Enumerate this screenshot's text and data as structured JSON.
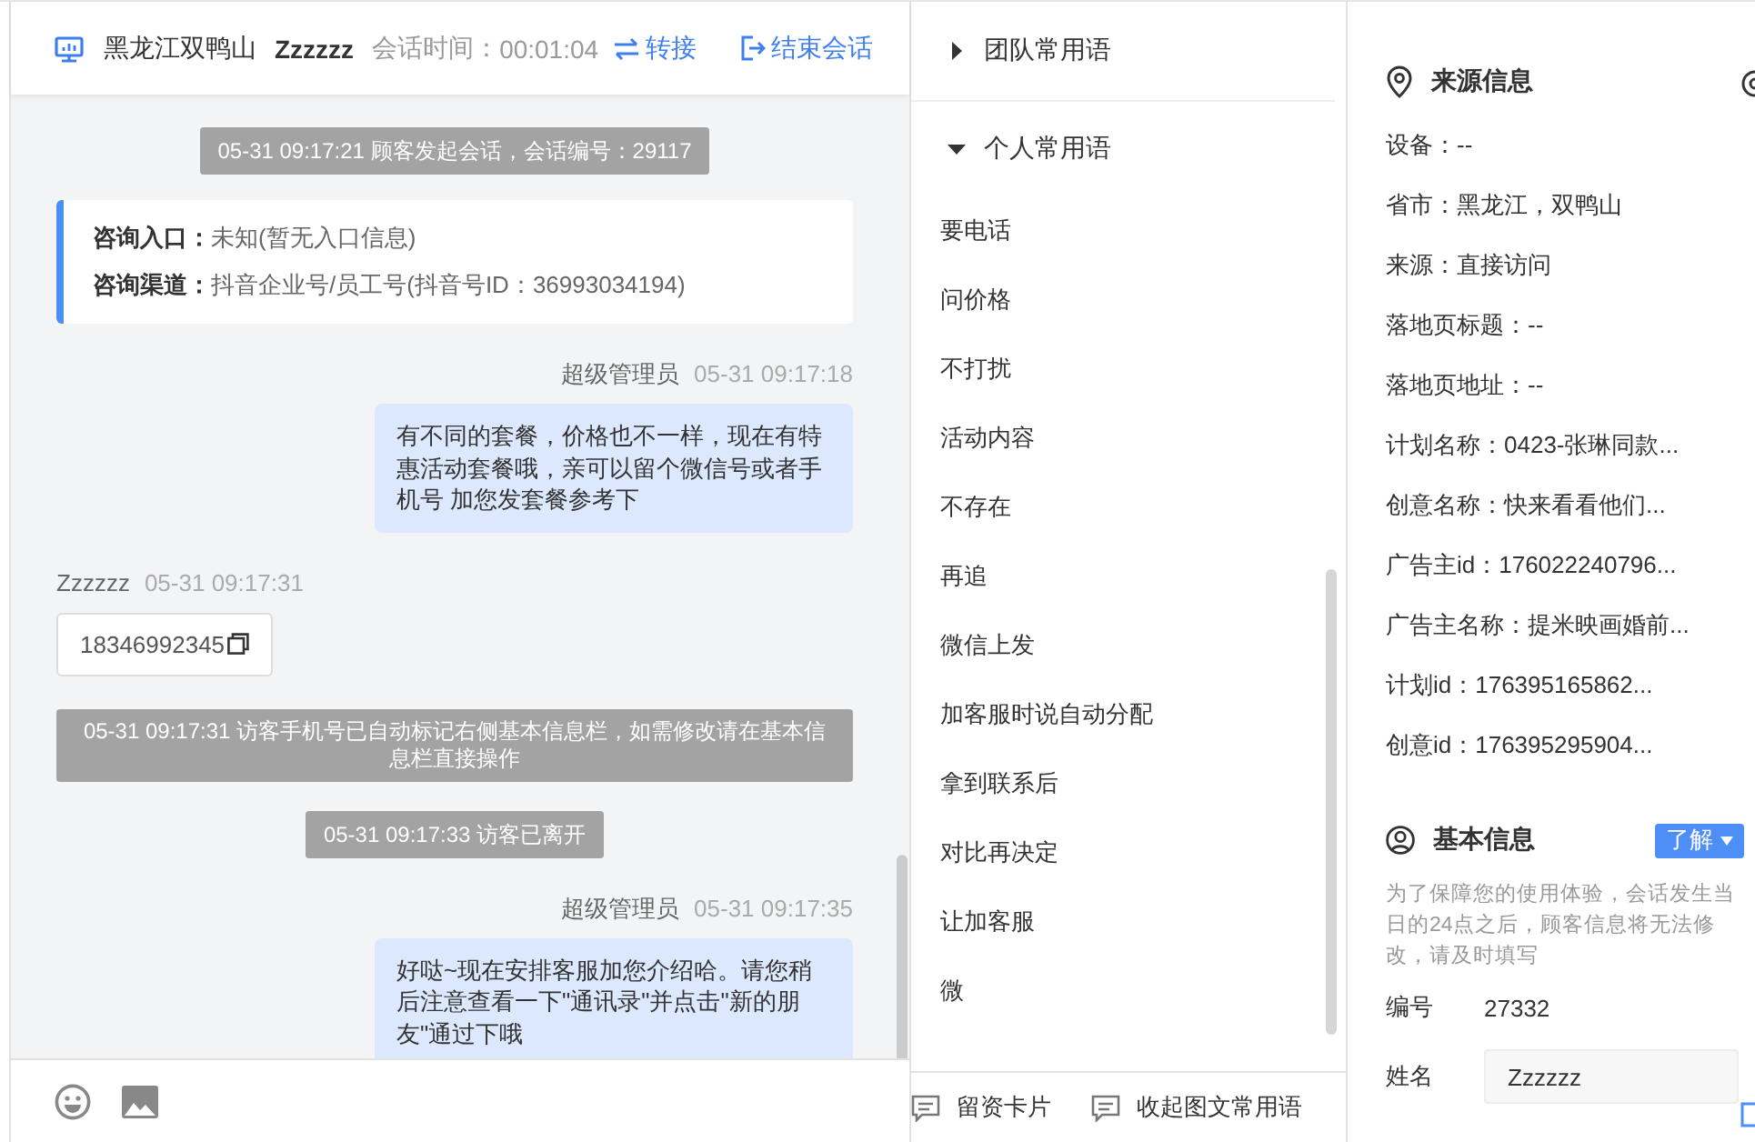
{
  "header": {
    "region": "黑龙江双鸭山",
    "visitor": "Zzzzzz",
    "duration_label": "会话时间：",
    "duration": "00:01:04",
    "transfer": "转接",
    "end": "结束会话"
  },
  "messages": [
    {
      "kind": "system",
      "text": "05-31 09:17:21 顾客发起会话，会话编号：29117"
    },
    {
      "kind": "info",
      "rows": [
        {
          "label": "咨询入口：",
          "value": "未知(暂无入口信息)"
        },
        {
          "label": "咨询渠道：",
          "value": "抖音企业号/员工号(抖音号ID：36993034194)"
        }
      ]
    },
    {
      "kind": "agent",
      "sender": "超级管理员",
      "time": "05-31 09:17:18",
      "text": "有不同的套餐，价格也不一样，现在有特惠活动套餐哦，亲可以留个微信号或者手机号 加您发套餐参考下"
    },
    {
      "kind": "visitor",
      "sender": "Zzzzzz",
      "time": "05-31 09:17:31",
      "text": "18346992345"
    },
    {
      "kind": "system",
      "text": "05-31 09:17:31 访客手机号已自动标记右侧基本信息栏，如需修改请在基本信息栏直接操作"
    },
    {
      "kind": "system",
      "text": "05-31 09:17:33 访客已离开"
    },
    {
      "kind": "agent",
      "sender": "超级管理员",
      "time": "05-31 09:17:35",
      "text": "好哒~现在安排客服加您介绍哈。请您稍后注意查看一下\"通讯录\"并点击\"新的朋友\"通过下哦"
    }
  ],
  "phrases": {
    "groups": [
      {
        "title": "团队常用语",
        "expanded": false
      },
      {
        "title": "个人常用语",
        "expanded": true,
        "items": [
          "要电话",
          "问价格",
          "不打扰",
          "活动内容",
          "不存在",
          "再追",
          "微信上发",
          "加客服时说自动分配",
          "拿到联系后",
          "对比再决定",
          "让加客服",
          "微"
        ]
      }
    ],
    "buttons": [
      "留资卡片",
      "收起图文常用语"
    ]
  },
  "source_info": {
    "title": "来源信息",
    "fields": [
      "设备：--",
      "省市：黑龙江，双鸭山",
      "来源：直接访问",
      "落地页标题：--",
      "落地页地址：--",
      "计划名称：0423-张琳同款...",
      "创意名称：快来看看他们...",
      "广告主id：176022240796...",
      "广告主名称：提米映画婚前...",
      "计划id：176395165862...",
      "创意id：176395295904..."
    ]
  },
  "basic_info": {
    "title": "基本信息",
    "learn_button": "了解",
    "notice": "为了保障您的使用体验，会话发生当日的24点之后，顾客信息将无法修改，请及时填写",
    "fields": [
      {
        "kind": "text",
        "label": "编号",
        "value": "27332"
      },
      {
        "kind": "input",
        "label": "姓名",
        "value": "Zzzzzz"
      }
    ]
  }
}
